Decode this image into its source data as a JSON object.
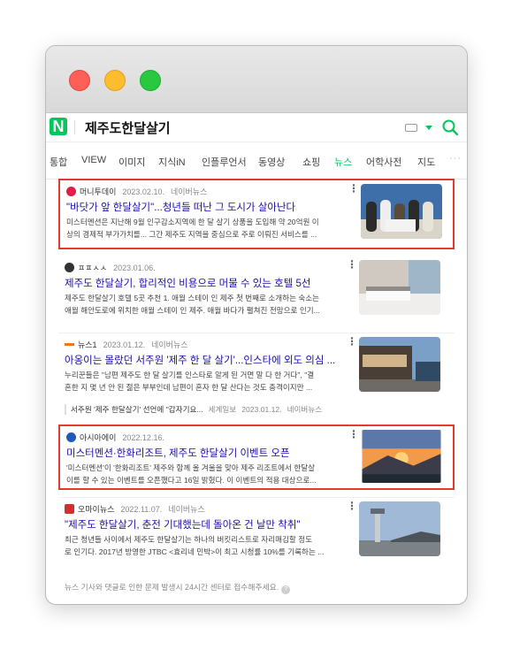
{
  "search": {
    "query": "제주도한달살기"
  },
  "tabs": [
    {
      "label": "통합"
    },
    {
      "label": "VIEW"
    },
    {
      "label": "이미지"
    },
    {
      "label": "지식iN"
    },
    {
      "label": "인플루언서"
    },
    {
      "label": "동영상"
    },
    {
      "label": "쇼핑"
    },
    {
      "label": "뉴스"
    },
    {
      "label": "어학사전"
    },
    {
      "label": "지도"
    }
  ],
  "active_tab": "뉴스",
  "more_label": "···",
  "results": [
    {
      "publisher": "머니투데이",
      "date": "2023.02.10.",
      "extra": "네이버뉴스",
      "title": "\"바닷가 앞 한달살기\"...청년들 떠난 그 도시가 살아난다",
      "body_line1": "미스터멘션은 지난해 9월 인구감소지역에 한 달 살기 상품을 도입해 약 20억원 이",
      "body_line2": "상의 경제적 부가가치를... 그간 제주도 지역을 중심으로 주로 이뤄진 서비스를 ...",
      "highlighted": true
    },
    {
      "publisher": "ㅍㅍㅅㅅ",
      "date": "2023.01.06.",
      "extra": "",
      "title": "제주도 한달살기, 합리적인 비용으로 머물 수 있는 호텔 5선",
      "body_line1": "제주도 한달살기 호텔 5곳 추천 1. 애월 스테이 인 제주 첫 번째로 소개하는 숙소는",
      "body_line2": "애월 해안도로에 위치한 애월 스테이 인 제주. 애월 바다가 펼쳐진 전망으로 인기...",
      "highlighted": false
    },
    {
      "publisher": "뉴스1",
      "date": "2023.01.12.",
      "extra": "네이버뉴스",
      "title": "아옹이는 몰랐던 서주원 '제주 한 달 살기'...인스타에 외도 의심 ...",
      "body_line1": "누리꾼들은 \"남편 제주도 한 달 살기를 인스타로 알게 된 거면 말 다 한 거다\", \"결",
      "body_line2": "혼한 지 몇 년 안 된 젊은 부부인데 남편이 혼자 한 달 산다는 것도 충격이지만 ...",
      "related": "서주원 '제주 한달살기' 선언에 \"갑자기요...",
      "related_pub": "세계일보",
      "related_date": "2023.01.12.",
      "related_extra": "네이버뉴스",
      "highlighted": false
    },
    {
      "publisher": "아시아에이",
      "date": "2022.12.16.",
      "extra": "",
      "title": "미스터멘션·한화리조트, 제주도 한달살기 이벤트 오픈",
      "body_line1": "'미스터멘션'이 '한화리조트' 제주와 함께 올 겨울을 맞아 제주 리조트에서 한달살",
      "body_line2": "이를 할 수 있는 이벤트를 오픈했다고 16일 밝혔다. 이 이벤트의 적용 대상으로...",
      "highlighted": true
    },
    {
      "publisher": "오마이뉴스",
      "date": "2022.11.07.",
      "extra": "네이버뉴스",
      "title": "\"제주도 한달살기, 춘전 기대했는데 돌아온 건 날만 착취\"",
      "body_line1": "최근 청년들 사이에서 제주도 한달살기는 하나의 버킷리스트로 자리매김할 정도",
      "body_line2": "로 인기다. 2017년 방영한 JTBC <효리네 민박>이 최고 시청률 10%를 기록하는 ...",
      "highlighted": false
    }
  ],
  "footer": {
    "note": "뉴스 기사와 댓글로 인한 문제 발생시 24시간 센터로 접수해주세요."
  },
  "colors": {
    "accent": "#03c75a",
    "link": "#1a0dab",
    "highlight_box": "#e53935"
  }
}
